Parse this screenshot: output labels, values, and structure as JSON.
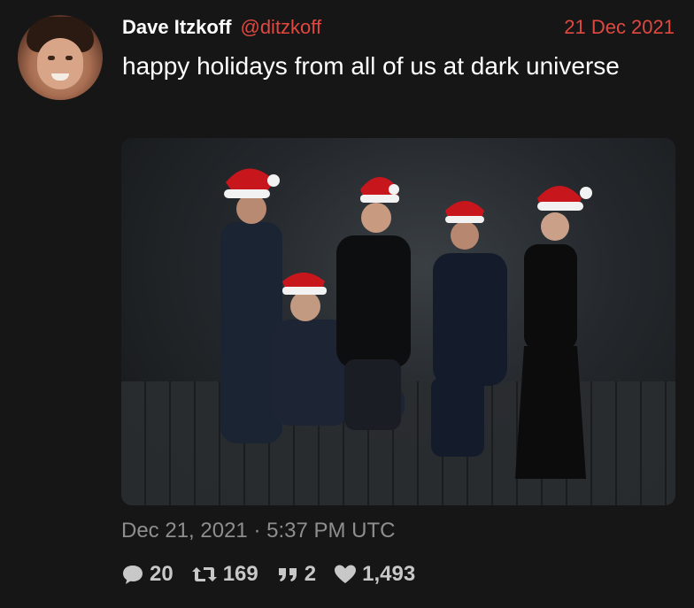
{
  "tweet": {
    "author_name": "Dave Itzkoff",
    "author_handle": "@ditzkoff",
    "date": "21 Dec 2021",
    "text": "happy holidays from all of us at dark universe",
    "timestamp": "Dec 21, 2021 · 5:37 PM UTC",
    "stats": {
      "replies": "20",
      "retweets": "169",
      "quotes": "2",
      "likes": "1,493"
    }
  },
  "icons": {
    "reply": "speech-bubble-icon",
    "retweet": "retweet-icon",
    "quote": "quote-icon",
    "like": "heart-icon"
  },
  "colors": {
    "background": "#161616",
    "accent": "#e04840",
    "muted": "#8e8e8e",
    "text": "#ffffff"
  }
}
